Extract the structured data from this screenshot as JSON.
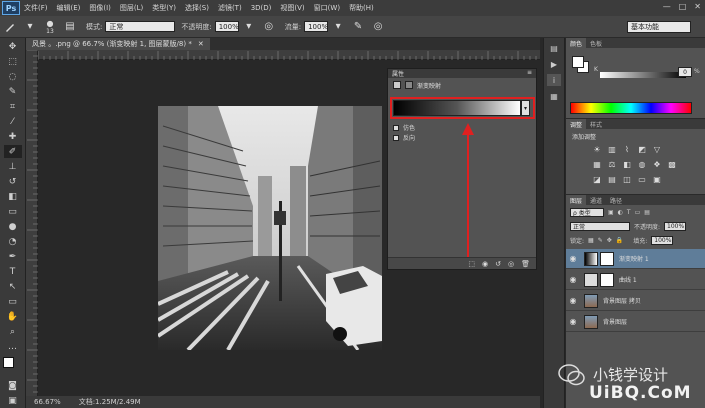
{
  "app": {
    "logo": "Ps"
  },
  "menu": [
    "文件(F)",
    "编辑(E)",
    "图像(I)",
    "图层(L)",
    "类型(Y)",
    "选择(S)",
    "滤镜(T)",
    "3D(D)",
    "视图(V)",
    "窗口(W)",
    "帮助(H)"
  ],
  "window_controls": [
    "—",
    "□",
    "✕"
  ],
  "options_bar": {
    "brush_size": "13",
    "mode_label": "模式:",
    "mode_value": "正常",
    "opacity_label": "不透明度:",
    "opacity_value": "100%",
    "flow_label": "流量:",
    "flow_value": "100%",
    "workspace": "基本功能"
  },
  "document": {
    "tab_title": "风景 。.png @ 66.7% (渐变映射 1, 图层蒙版/8) *",
    "zoom": "66.67%",
    "doc_size": "文档:1.25M/2.49M"
  },
  "properties": {
    "header": "属性",
    "type_label": "渐变映射",
    "dither_label": "仿色",
    "reverse_label": "反向",
    "gradient_colors": [
      "#000000",
      "#ffffff"
    ],
    "highlight_color": "#e02020"
  },
  "color_panel": {
    "tabs": [
      "颜色",
      "色板"
    ],
    "channel": "K",
    "k_value": "0",
    "unit": "%"
  },
  "adjustments_panel": {
    "tabs": [
      "调整",
      "样式"
    ],
    "title": "添加调整"
  },
  "layers_panel": {
    "tabs": [
      "图层",
      "通道",
      "路径"
    ],
    "filter_label": "ρ 类型",
    "blend_mode": "正常",
    "opacity_label": "不透明度:",
    "opacity_value": "100%",
    "lock_label": "锁定:",
    "fill_label": "填充:",
    "fill_value": "100%",
    "layers": [
      {
        "name": "渐变映射 1",
        "selected": true
      },
      {
        "name": "曲线 1",
        "selected": false
      },
      {
        "name": "背景图层 拷贝",
        "selected": false
      },
      {
        "name": "背景图层",
        "selected": false
      }
    ]
  },
  "watermark": {
    "line1": "小钱学设计",
    "line2": "UiBQ.CoM"
  }
}
